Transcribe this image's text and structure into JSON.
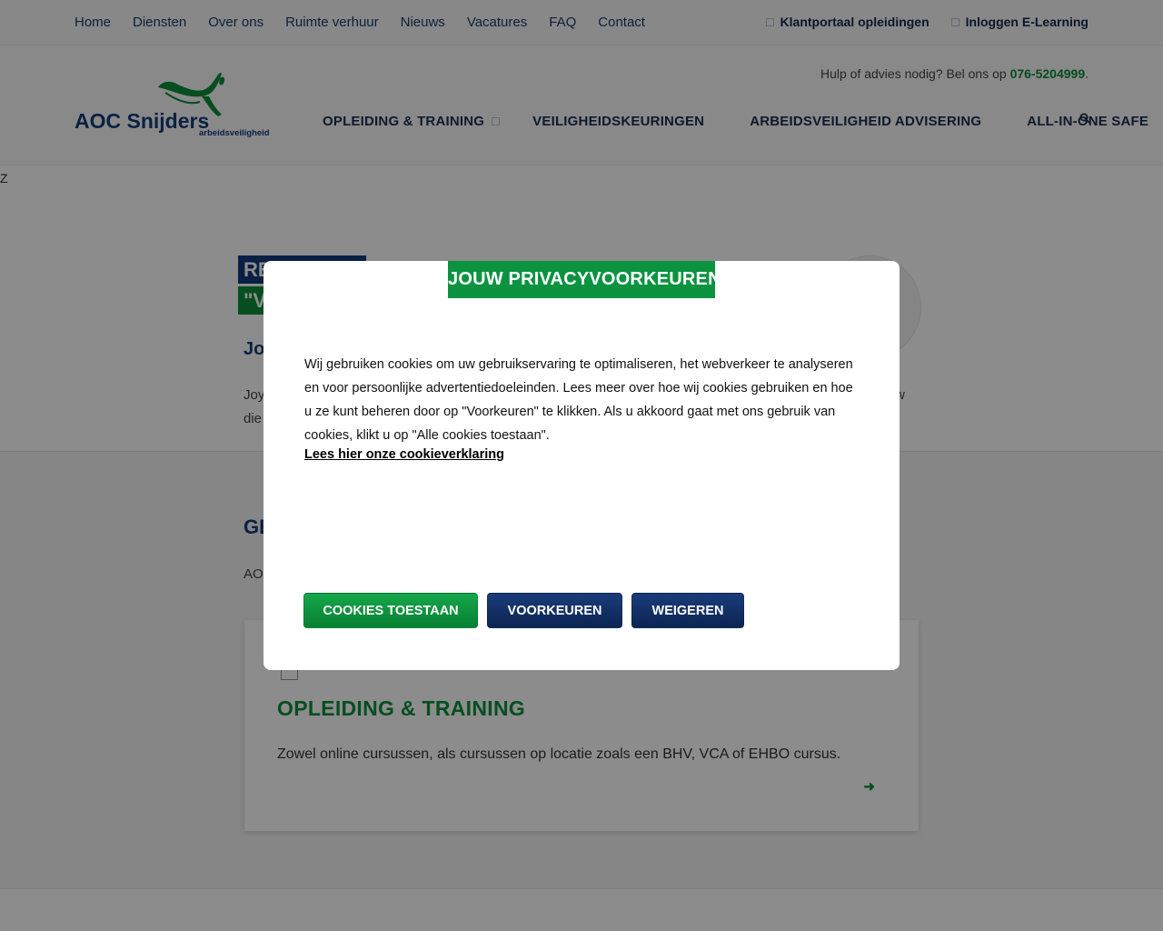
{
  "topbar": {
    "nav": [
      "Home",
      "Diensten",
      "Over ons",
      "Ruimte verhuur",
      "Nieuws",
      "Vacatures",
      "FAQ",
      "Contact"
    ],
    "links": [
      "Klantportaal opleidingen",
      "Inloggen E-Learning"
    ]
  },
  "header": {
    "help_text": "Hulp of advies nodig? Bel ons op ",
    "phone": "076-5204999",
    "help_suffix": ".",
    "logo": {
      "brand": "AOC Snijders",
      "tagline": "arbeidsveiligheid"
    },
    "main_nav": [
      "OPLEIDING & TRAINING",
      "VEILIGHEIDSKEURINGEN",
      "ARBEIDSVEILIGHEID ADVISERING",
      "ALL-IN-ONE SAFE"
    ],
    "search_icon": "search-icon"
  },
  "stray_char": "Z",
  "hero": {
    "badge1": "RE",
    "badge2": "\"V",
    "name": "Jo",
    "text_line1": "Joy",
    "text_line2": "die",
    "text_right": "w"
  },
  "section": {
    "title": "GE",
    "text": "AO",
    "card": {
      "title": "OPLEIDING & TRAINING",
      "text": "Zowel online cursussen, als cursussen op locatie zoals een BHV, VCA of EHBO cursus.",
      "arrow": "➜"
    }
  },
  "modal": {
    "title": "JOUW PRIVACYVOORKEUREN",
    "body": "Wij gebruiken cookies om uw gebruikservaring te optimaliseren, het webverkeer te analyseren en voor persoonlijke advertentiedoeleinden. Lees meer over hoe wij cookies gebruiken en hoe u ze kunt beheren door op \"Voorkeuren\" te klikken. Als u akkoord gaat met ons gebruik van cookies, klikt u op \"Alle cookies toestaan\".",
    "link": "Lees hier onze cookieverklaring",
    "buttons": {
      "accept": "COOKIES TOESTAAN",
      "prefs": "VOORKEUREN",
      "reject": "WEIGEREN"
    }
  },
  "colors": {
    "brand_blue": "#133c7a",
    "brand_green": "#0b8f3b",
    "dark_navy": "#0b2552"
  }
}
